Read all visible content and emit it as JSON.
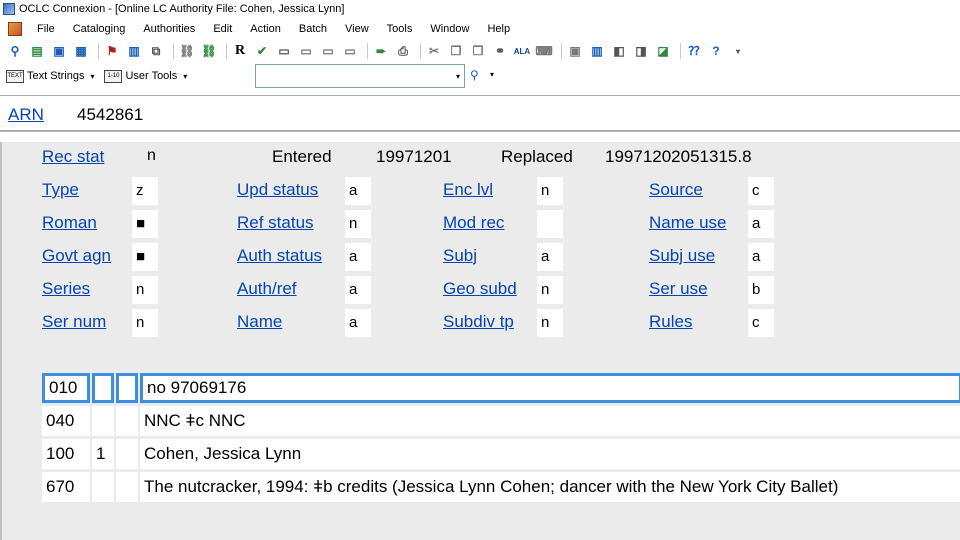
{
  "window": {
    "title": "OCLC Connexion - [Online LC Authority File: Cohen, Jessica Lynn]"
  },
  "menubar": {
    "items": [
      "File",
      "Cataloging",
      "Authorities",
      "Edit",
      "Action",
      "Batch",
      "View",
      "Tools",
      "Window",
      "Help"
    ]
  },
  "toolbar2": {
    "text_strings": "Text Strings",
    "user_tools": "User Tools",
    "combo_value": ""
  },
  "arn": {
    "label": "ARN",
    "value": "4542861"
  },
  "fixed_fields": {
    "rec_stat_label": "Rec stat",
    "rec_stat_value": "n",
    "entered_label": "Entered",
    "entered_value": "19971201",
    "replaced_label": "Replaced",
    "replaced_value": "19971202051315.8",
    "rows": [
      [
        {
          "label": "Type",
          "value": "z"
        },
        {
          "label": "Upd status",
          "value": "a"
        },
        {
          "label": "Enc lvl",
          "value": "n"
        },
        {
          "label": "Source",
          "value": "c"
        }
      ],
      [
        {
          "label": "Roman",
          "value": "■"
        },
        {
          "label": "Ref status",
          "value": "n"
        },
        {
          "label": "Mod rec",
          "value": ""
        },
        {
          "label": "Name use",
          "value": "a"
        }
      ],
      [
        {
          "label": "Govt agn",
          "value": "■"
        },
        {
          "label": "Auth status",
          "value": "a"
        },
        {
          "label": "Subj",
          "value": "a"
        },
        {
          "label": "Subj use",
          "value": "a"
        }
      ],
      [
        {
          "label": "Series",
          "value": "n"
        },
        {
          "label": "Auth/ref",
          "value": "a"
        },
        {
          "label": "Geo subd",
          "value": "n"
        },
        {
          "label": "Ser use",
          "value": "b"
        }
      ],
      [
        {
          "label": "Ser num",
          "value": "n"
        },
        {
          "label": "Name",
          "value": "a"
        },
        {
          "label": "Subdiv tp",
          "value": "n"
        },
        {
          "label": "Rules",
          "value": "c"
        }
      ]
    ]
  },
  "variable_fields": [
    {
      "tag": "010",
      "ind1": "",
      "ind2": "",
      "content": "no 97069176",
      "selected": true
    },
    {
      "tag": "040",
      "ind1": "",
      "ind2": "",
      "content": "NNC ǂc NNC",
      "selected": false
    },
    {
      "tag": "100",
      "ind1": "1",
      "ind2": "",
      "content": "Cohen, Jessica Lynn",
      "selected": false
    },
    {
      "tag": "670",
      "ind1": "",
      "ind2": "",
      "content": "The nutcracker, 1994: ǂb credits (Jessica Lynn Cohen; dancer with the New York City Ballet)",
      "selected": false
    }
  ]
}
